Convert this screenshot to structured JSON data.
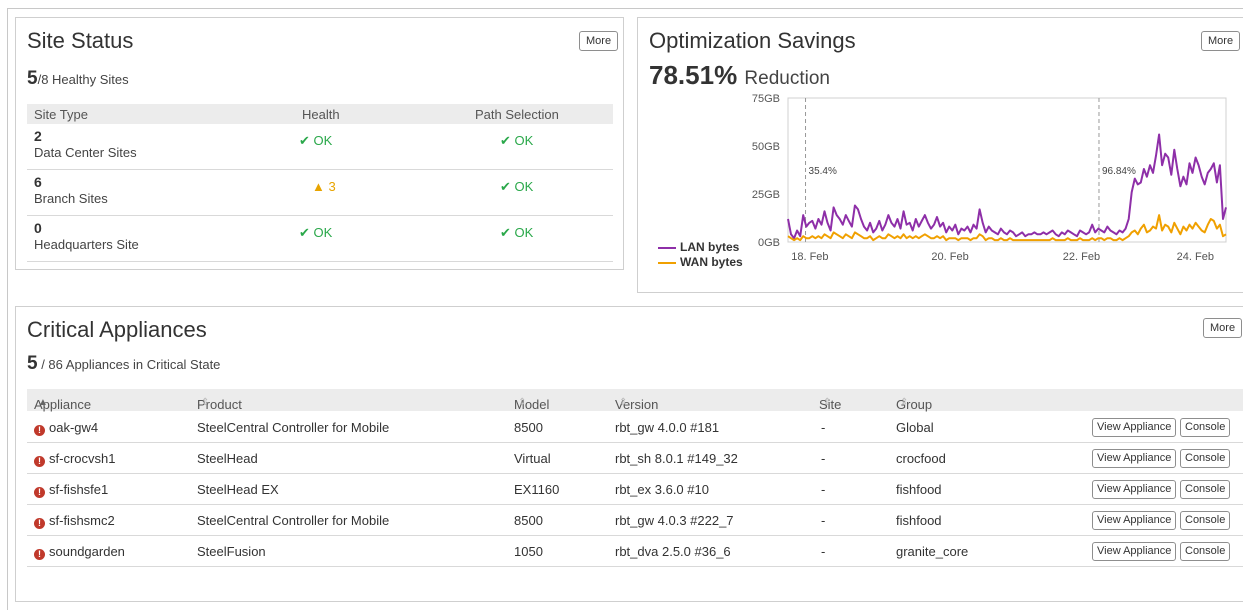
{
  "site_status": {
    "title": "Site Status",
    "more_label": "More",
    "healthy_count": "5",
    "healthy_rest": "/8 Healthy Sites",
    "columns": [
      "Site Type",
      "Health",
      "Path Selection"
    ],
    "rows": [
      {
        "count": "2",
        "label": "Data Center Sites",
        "health": "✔ OK",
        "health_state": "ok",
        "path": "✔ OK"
      },
      {
        "count": "6",
        "label": "Branch Sites",
        "health": "▲ 3",
        "health_state": "warn",
        "path": "✔ OK"
      },
      {
        "count": "0",
        "label": "Headquarters Site",
        "health": "✔ OK",
        "health_state": "ok",
        "path": "✔ OK"
      }
    ]
  },
  "optimization": {
    "title": "Optimization Savings",
    "more_label": "More",
    "reduction_value": "78.51%",
    "reduction_label": "Reduction",
    "legend": [
      {
        "name": "LAN bytes",
        "color": "#8e2fa8"
      },
      {
        "name": "WAN bytes",
        "color": "#f0a000"
      }
    ]
  },
  "chart_data": {
    "type": "line",
    "x_tick_labels": [
      "18. Feb",
      "20. Feb",
      "22. Feb",
      "24. Feb"
    ],
    "y_tick_labels": [
      "75GB",
      "50GB",
      "25GB",
      "0GB"
    ],
    "ylim": [
      0,
      75
    ],
    "y_unit": "GB",
    "annotations": [
      {
        "x": 0.04,
        "label": "35.4%"
      },
      {
        "x": 0.71,
        "label": "96.84%"
      }
    ],
    "series": [
      {
        "name": "LAN bytes",
        "color": "#8e2fa8",
        "values": [
          12,
          4,
          2,
          6,
          3,
          14,
          8,
          10,
          11,
          7,
          12,
          9,
          16,
          10,
          6,
          18,
          14,
          12,
          9,
          14,
          11,
          8,
          19,
          17,
          12,
          8,
          6,
          10,
          5,
          7,
          11,
          6,
          9,
          14,
          10,
          8,
          12,
          7,
          16,
          9,
          10,
          6,
          12,
          8,
          11,
          14,
          10,
          7,
          9,
          13,
          8,
          10,
          5,
          8,
          6,
          9,
          4,
          7,
          6,
          8,
          5,
          9,
          7,
          17,
          10,
          5,
          8,
          6,
          5,
          4,
          7,
          5,
          4,
          6,
          5,
          3,
          4,
          5,
          3,
          4,
          4,
          5,
          4,
          4,
          5,
          4,
          5,
          6,
          4,
          3,
          5,
          4,
          6,
          5,
          4,
          3,
          6,
          5,
          4,
          5,
          9,
          5,
          7,
          6,
          5,
          8,
          6,
          5,
          4,
          6,
          5,
          7,
          12,
          26,
          33,
          30,
          31,
          38,
          34,
          40,
          36,
          45,
          56,
          40,
          46,
          44,
          35,
          48,
          38,
          29,
          34,
          30,
          41,
          36,
          44,
          40,
          34,
          30,
          36,
          38,
          41,
          31,
          40,
          12,
          18
        ]
      },
      {
        "name": "WAN bytes",
        "color": "#f0a000",
        "values": [
          3,
          2,
          1,
          2,
          1,
          3,
          2,
          2,
          3,
          2,
          3,
          2,
          4,
          3,
          2,
          5,
          4,
          3,
          2,
          4,
          3,
          2,
          5,
          4,
          3,
          2,
          2,
          3,
          1,
          2,
          3,
          2,
          2,
          4,
          3,
          2,
          3,
          2,
          4,
          2,
          3,
          2,
          3,
          2,
          3,
          4,
          3,
          2,
          2,
          3,
          2,
          3,
          1,
          2,
          2,
          2,
          1,
          2,
          2,
          2,
          1,
          2,
          2,
          4,
          3,
          1,
          2,
          2,
          1,
          1,
          2,
          1,
          1,
          2,
          1,
          1,
          1,
          1,
          1,
          1,
          1,
          1,
          1,
          1,
          1,
          1,
          1,
          2,
          1,
          1,
          1,
          1,
          2,
          1,
          1,
          1,
          2,
          1,
          1,
          1,
          2,
          1,
          2,
          2,
          1,
          2,
          2,
          1,
          1,
          2,
          1,
          2,
          3,
          5,
          6,
          4,
          7,
          9,
          5,
          6,
          8,
          7,
          14,
          6,
          9,
          8,
          5,
          10,
          7,
          4,
          8,
          6,
          9,
          7,
          10,
          8,
          6,
          5,
          9,
          12,
          11,
          7,
          9,
          3,
          4
        ]
      }
    ]
  },
  "critical": {
    "title": "Critical Appliances",
    "more_label": "More",
    "critical_count": "5",
    "critical_rest": "/ 86 Appliances in Critical State",
    "columns": [
      "Appliance",
      "Product",
      "Model",
      "Version",
      "Site",
      "Group"
    ],
    "view_label": "View Appliance",
    "console_label": "Console",
    "rows": [
      {
        "appliance": "oak-gw4",
        "product": "SteelCentral Controller for Mobile",
        "model": "8500",
        "version": "rbt_gw 4.0.0 #181",
        "site": "-",
        "group": "Global"
      },
      {
        "appliance": "sf-crocvsh1",
        "product": "SteelHead",
        "model": "Virtual",
        "version": "rbt_sh 8.0.1 #149_32",
        "site": "-",
        "group": "crocfood"
      },
      {
        "appliance": "sf-fishsfe1",
        "product": "SteelHead EX",
        "model": "EX1160",
        "version": "rbt_ex 3.6.0 #10",
        "site": "-",
        "group": "fishfood"
      },
      {
        "appliance": "sf-fishsmc2",
        "product": "SteelCentral Controller for Mobile",
        "model": "8500",
        "version": "rbt_gw 4.0.3 #222_7",
        "site": "-",
        "group": "fishfood"
      },
      {
        "appliance": "soundgarden",
        "product": "SteelFusion",
        "model": "1050",
        "version": "rbt_dva 2.5.0 #36_6",
        "site": "-",
        "group": "granite_core"
      }
    ]
  }
}
